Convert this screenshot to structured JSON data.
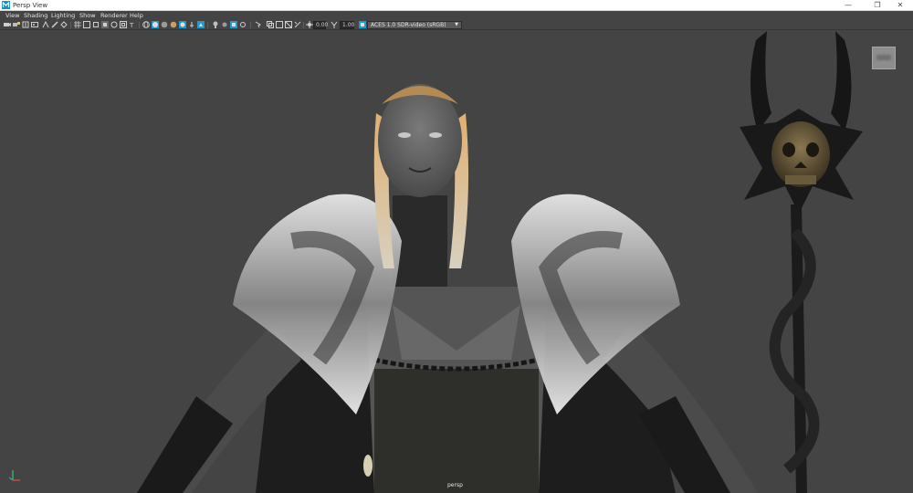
{
  "window": {
    "title": "Persp View",
    "minimize_glyph": "—",
    "restore_glyph": "❐",
    "close_glyph": "✕"
  },
  "menu": {
    "items": [
      "View",
      "Shading",
      "Lighting",
      "Show",
      "Renderer",
      "Help"
    ]
  },
  "toolbar": {
    "exposure_value": "0.00",
    "gamma_value": "1.00",
    "colorspace_label": "ACES 1.0 SDR-video (sRGB)",
    "colorspace_arrow": "▼"
  },
  "viewport": {
    "camera_label": "persp"
  },
  "colors": {
    "accent": "#1e9bd0",
    "viewport_bg": "#444444",
    "panel_bg": "#444444"
  }
}
